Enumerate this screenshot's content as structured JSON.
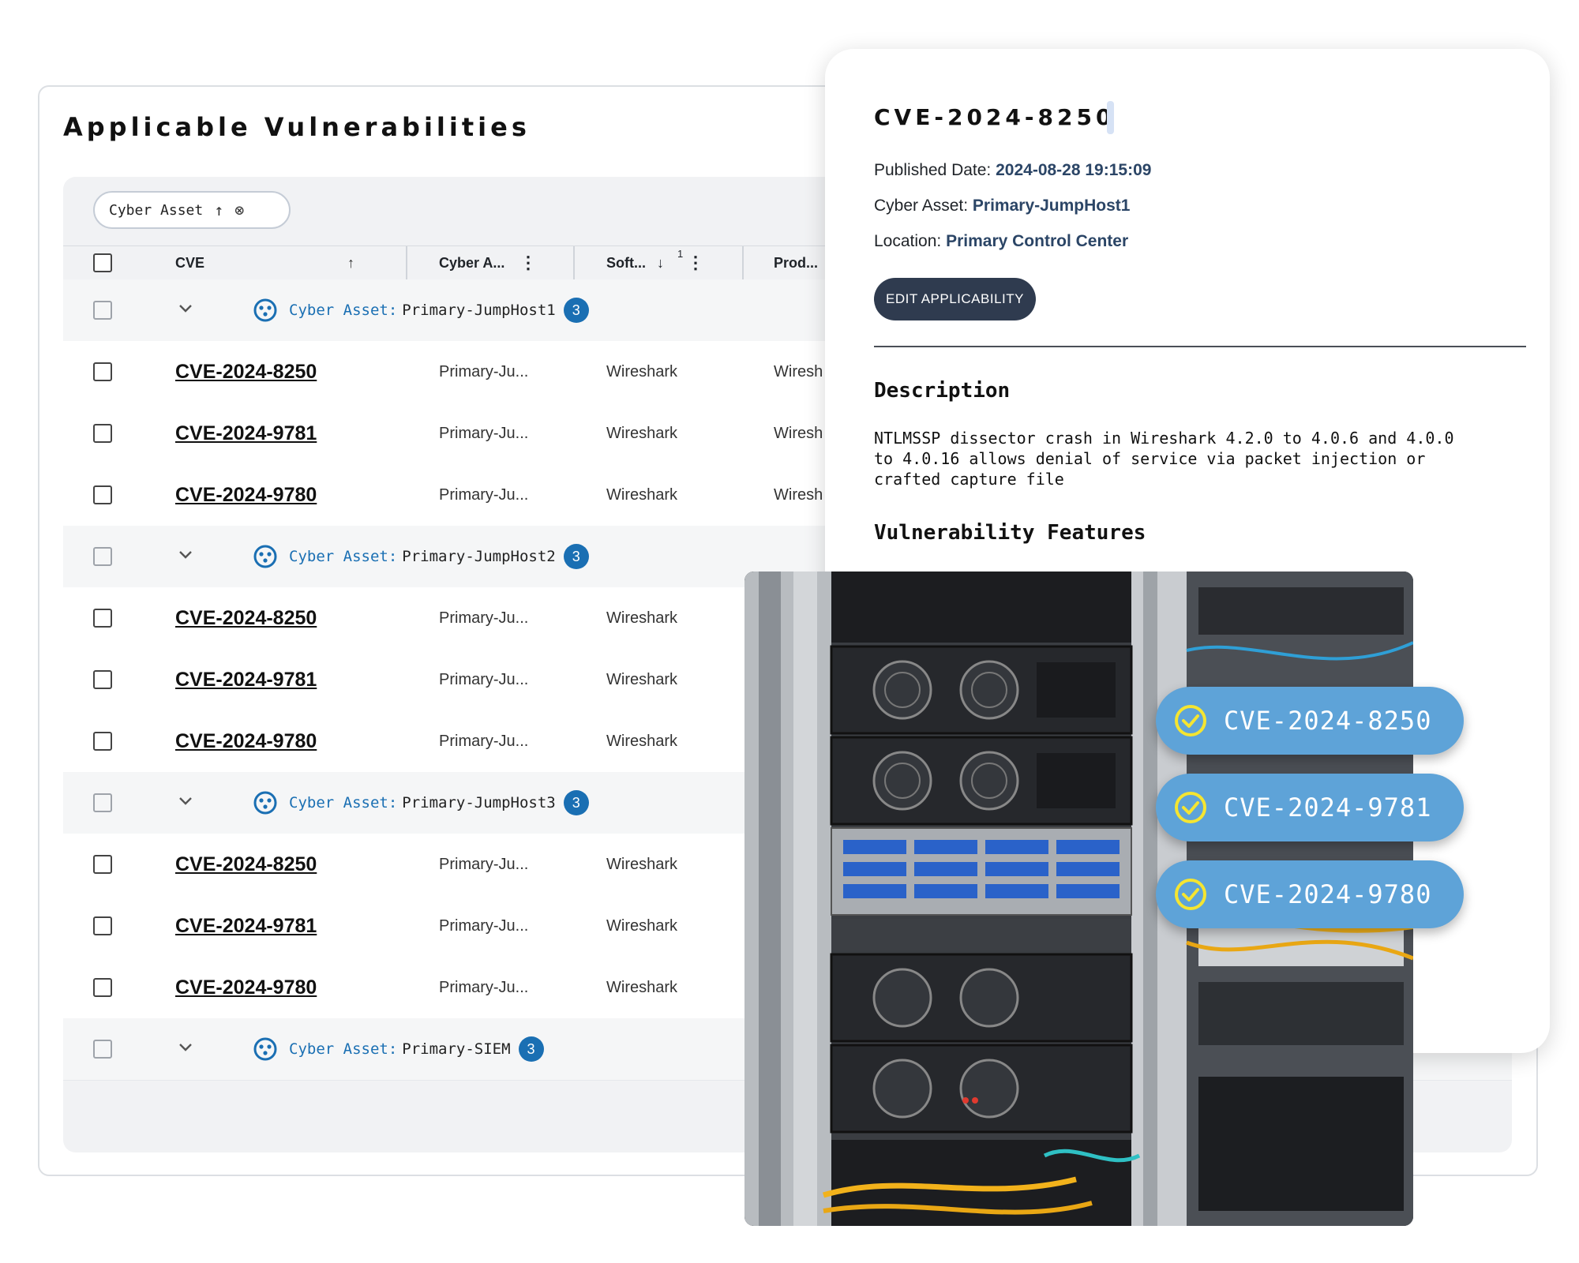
{
  "page": {
    "title": "Applicable Vulnerabilities"
  },
  "grouping_chip": {
    "label": "Cyber Asset"
  },
  "columns": {
    "cve": "CVE",
    "cyber_asset": "Cyber A...",
    "software": "Soft...",
    "software_sort_index": "1",
    "product": "Prod..."
  },
  "groups": [
    {
      "key": "Cyber Asset:",
      "value": "Primary-JumpHost1",
      "count": "3",
      "rows": [
        {
          "cve": "CVE-2024-8250",
          "asset": "Primary-Ju...",
          "software": "Wireshark",
          "product": "Wiresh"
        },
        {
          "cve": "CVE-2024-9781",
          "asset": "Primary-Ju...",
          "software": "Wireshark",
          "product": "Wiresh"
        },
        {
          "cve": "CVE-2024-9780",
          "asset": "Primary-Ju...",
          "software": "Wireshark",
          "product": "Wiresh"
        }
      ]
    },
    {
      "key": "Cyber Asset:",
      "value": "Primary-JumpHost2",
      "count": "3",
      "rows": [
        {
          "cve": "CVE-2024-8250",
          "asset": "Primary-Ju...",
          "software": "Wireshark"
        },
        {
          "cve": "CVE-2024-9781",
          "asset": "Primary-Ju...",
          "software": "Wireshark"
        },
        {
          "cve": "CVE-2024-9780",
          "asset": "Primary-Ju...",
          "software": "Wireshark"
        }
      ]
    },
    {
      "key": "Cyber Asset:",
      "value": "Primary-JumpHost3",
      "count": "3",
      "rows": [
        {
          "cve": "CVE-2024-8250",
          "asset": "Primary-Ju...",
          "software": "Wireshark"
        },
        {
          "cve": "CVE-2024-9781",
          "asset": "Primary-Ju...",
          "software": "Wireshark"
        },
        {
          "cve": "CVE-2024-9780",
          "asset": "Primary-Ju...",
          "software": "Wireshark"
        }
      ]
    },
    {
      "key": "Cyber Asset:",
      "value": "Primary-SIEM",
      "count": "3",
      "rows": []
    }
  ],
  "detail": {
    "title": "CVE-2024-8250",
    "published_label": "Published Date:",
    "published_value": "2024-08-28 19:15:09",
    "asset_label": "Cyber Asset:",
    "asset_value": "Primary-JumpHost1",
    "location_label": "Location:",
    "location_value": "Primary Control Center",
    "edit_button": "EDIT APPLICABILITY",
    "description_heading": "Description",
    "description_text": "NTLMSSP dissector crash in Wireshark 4.2.0 to 4.0.6 and 4.0.0\nto 4.0.16 allows denial of service via packet injection or\ncrafted capture file",
    "features_heading": "Vulnerability Features"
  },
  "badges": [
    {
      "label": "CVE-2024-8250"
    },
    {
      "label": "CVE-2024-9781"
    },
    {
      "label": "CVE-2024-9780"
    }
  ],
  "pager": {
    "next_icon": "chevron-right-icon",
    "last_icon": "last-page-icon"
  },
  "colors": {
    "accent_blue": "#1a6fb3",
    "pill_blue": "#5ea3d8",
    "check_yellow": "#f5e531",
    "button_dark": "#2f3b4f",
    "value_text": "#2b4566"
  }
}
